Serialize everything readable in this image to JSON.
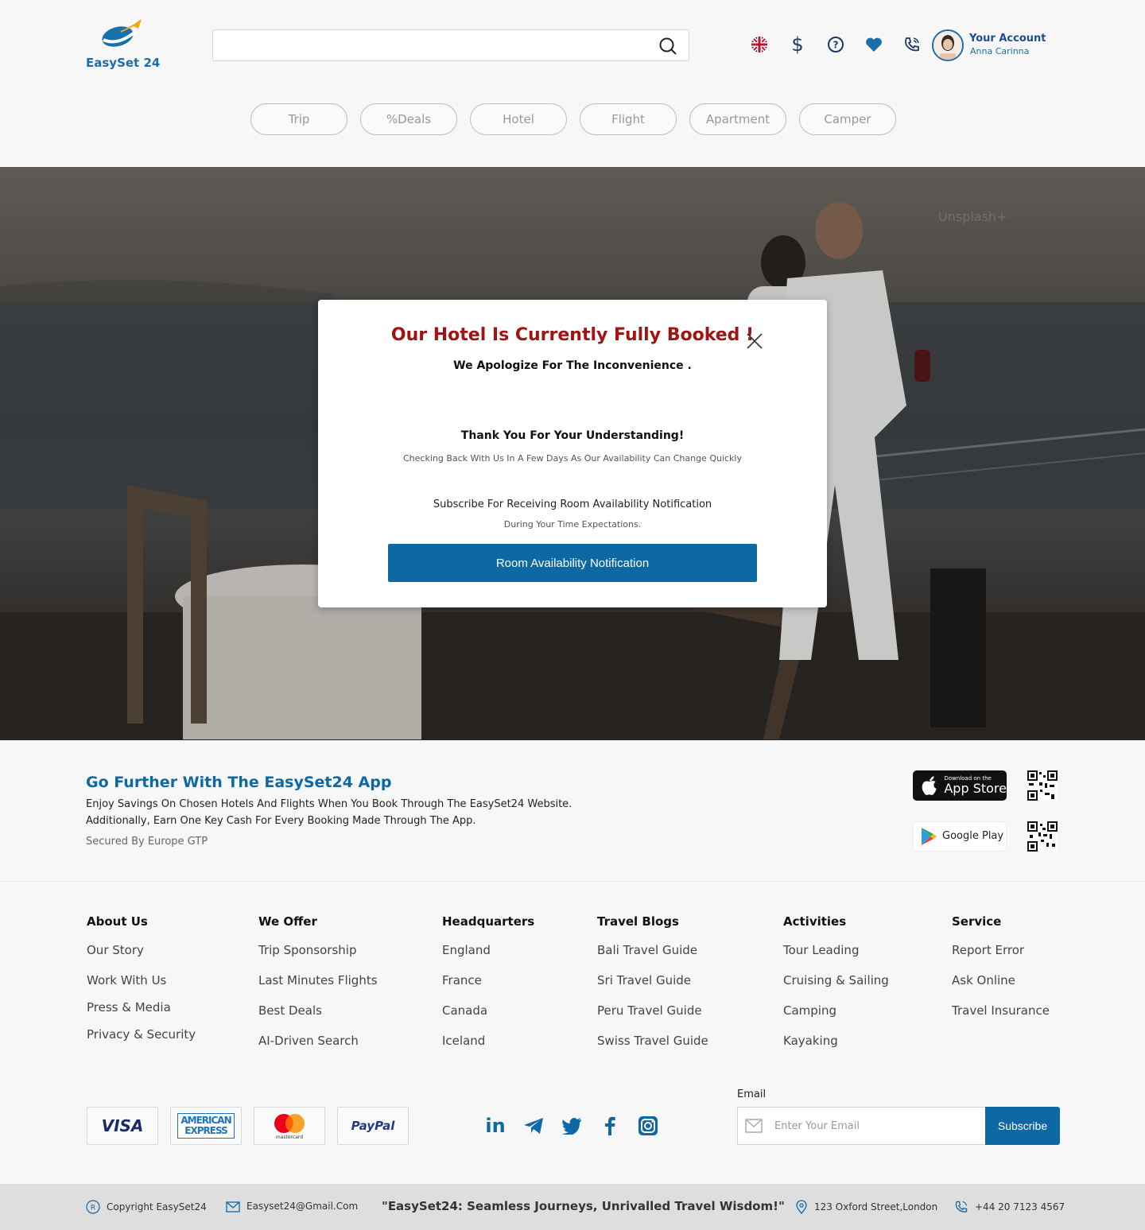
{
  "brand": {
    "name": "EasySet 24",
    "primary": "#0e68a4",
    "alert": "#a11414"
  },
  "header": {
    "search_placeholder": "",
    "icons": [
      "uk-flag-icon",
      "dollar-icon",
      "help-icon",
      "heart-icon",
      "phone-icon"
    ],
    "account": {
      "title": "Your Account",
      "name": "Anna Carinna"
    }
  },
  "tabs": [
    "Trip",
    "%Deals",
    "Hotel",
    "Flight",
    "Apartment",
    "Camper"
  ],
  "hero": {
    "watermark": "Unsplash+"
  },
  "modal": {
    "title": "Our Hotel Is Currently Fully Booked !",
    "subtitle": "We Apologize For The Inconvenience .",
    "thanks": "Thank You For Your Understanding!",
    "check_back": "Checking Back With Us In A Few Days As Our Availability Can Change Quickly",
    "subscribe": "Subscribe For Receiving Room Availability Notification",
    "during": "During Your Time Expectations.",
    "button": "Room Availability Notification"
  },
  "app": {
    "title": "Go Further With The EasySet24 App",
    "line1": "Enjoy Savings On Chosen Hotels And Flights When You Book Through The EasySet24 Website.",
    "line2": "Additionally, Earn One Key Cash For Every Booking Made Through The App.",
    "secured": "Secured By Europe GTP",
    "appstore_small": "Download on the",
    "appstore_big": "App Store",
    "googleplay": "Google Play"
  },
  "footer": {
    "columns": [
      {
        "heading": "About Us",
        "items": [
          "Our Story",
          "Work With Us",
          "Press & Media",
          "Privacy & Security"
        ]
      },
      {
        "heading": "We Offer",
        "items": [
          "Trip Sponsorship",
          "Last Minutes Flights",
          "Best Deals",
          "AI-Driven Search"
        ]
      },
      {
        "heading": "Headquarters",
        "items": [
          "England",
          "France",
          "Canada",
          "Iceland"
        ]
      },
      {
        "heading": "Travel Blogs",
        "items": [
          "Bali Travel Guide",
          "Sri Travel Guide",
          "Peru Travel Guide",
          "Swiss Travel Guide"
        ]
      },
      {
        "heading": "Activities",
        "items": [
          "Tour Leading",
          "Cruising & Sailing",
          "Camping",
          "Kayaking"
        ]
      },
      {
        "heading": "Service",
        "items": [
          "Report Error",
          "Ask Online",
          "Travel Insurance"
        ]
      }
    ],
    "payments": {
      "visa": "VISA",
      "amex_1": "AMERICAN",
      "amex_2": "EXPRESS",
      "mastercard": "mastercard",
      "paypal": "PayPal"
    },
    "social": [
      "linkedin-icon",
      "telegram-icon",
      "twitter-icon",
      "facebook-icon",
      "instagram-icon"
    ],
    "email_label": "Email",
    "email_placeholder": "Enter Your Email",
    "subscribe": "Subscribe"
  },
  "bottom": {
    "copyright": "Copyright EasySet24",
    "email": "Easyset24@Gmail.Com",
    "quote": "\"EasySet24: Seamless Journeys, Unrivalled Travel Wisdom!\"",
    "address": "123 Oxford Street,London",
    "phone": "+44 20 7123 4567"
  }
}
